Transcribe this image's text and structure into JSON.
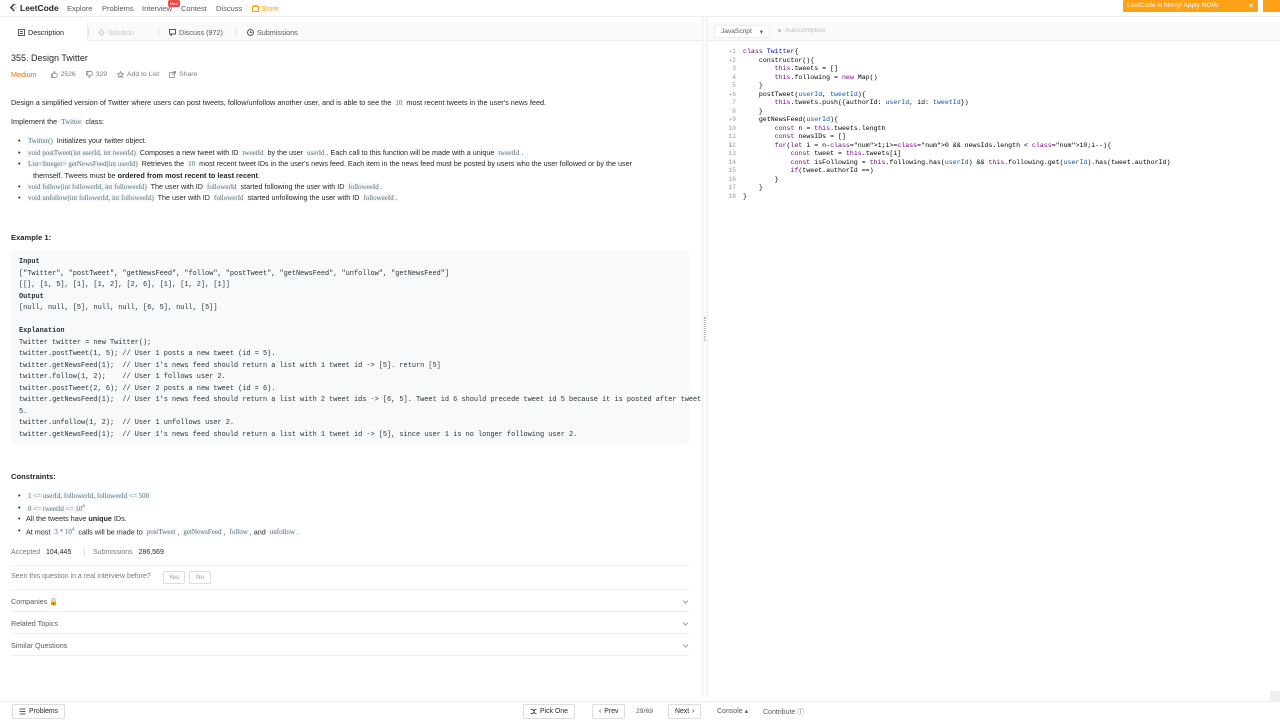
{
  "nav": {
    "logo": "LeetCode",
    "links": [
      "Explore",
      "Problems",
      "Interview",
      "Contest",
      "Discuss",
      "Store"
    ],
    "new_badge": "New",
    "hiring": "LeetCode is hiring! Apply NOW."
  },
  "tabs": [
    {
      "label": "Description",
      "state": "active"
    },
    {
      "label": "Solution",
      "state": "disabled"
    },
    {
      "label": "Discuss (972)",
      "state": "normal"
    },
    {
      "label": "Submissions",
      "state": "normal"
    }
  ],
  "question": {
    "title": "355. Design Twitter",
    "difficulty": "Medium",
    "likes": "2526",
    "dislikes": "329",
    "add_to_list": "Add to List",
    "share": "Share",
    "desc_a": "Design a simplified version of Twitter where users can post tweets, follow/unfollow another user, and is able to see the",
    "desc_code": "10",
    "desc_b": "most recent tweets in the user's news feed.",
    "implement_a": "Implement the",
    "implement_code": "Twitter",
    "implement_b": "class:",
    "methods": [
      {
        "sig": "Twitter()",
        "text": "Initializes your twitter object."
      },
      {
        "sig": "void postTweet(int userId, int tweetId)",
        "text_a": "Composes a new tweet with ID",
        "c1": "tweetId",
        "text_b": "by the user",
        "c2": "userId",
        "text_c": ". Each call to this function will be made with a unique",
        "c3": "tweetId",
        "text_d": "."
      },
      {
        "sig": "List<Integer> getNewsFeed(int userId)",
        "text_a": "Retrieves the",
        "c1": "10",
        "text_b": "most recent tweet IDs in the user's news feed. Each item in the news feed must be posted by users who the user followed or by the user",
        "line2_a": "themself. Tweets must be",
        "line2_bold": "ordered from most recent to least recent",
        "line2_b": "."
      },
      {
        "sig": "void follow(int followerId, int followeeId)",
        "text_a": "The user with ID",
        "c1": "followerId",
        "text_b": "started following the user with ID",
        "c2": "followeeId",
        "text_c": "."
      },
      {
        "sig": "void unfollow(int followerId, int followeeId)",
        "text_a": "The user with ID",
        "c1": "followerId",
        "text_b": "started unfollowing the user with ID",
        "c2": "followeeId",
        "text_c": "."
      }
    ],
    "example_title": "Example 1:",
    "example": {
      "input_label": "Input",
      "input_1": "[\"Twitter\", \"postTweet\", \"getNewsFeed\", \"follow\", \"postTweet\", \"getNewsFeed\", \"unfollow\", \"getNewsFeed\"]",
      "input_2": "[[], [1, 5], [1], [1, 2], [2, 6], [1], [1, 2], [1]]",
      "output_label": "Output",
      "output_1": "[null, null, [5], null, null, [6, 5], null, [5]]",
      "explanation_label": "Explanation",
      "explanation": [
        "Twitter twitter = new Twitter();",
        "twitter.postTweet(1, 5); // User 1 posts a new tweet (id = 5).",
        "twitter.getNewsFeed(1);  // User 1's news feed should return a list with 1 tweet id -> [5]. return [5]",
        "twitter.follow(1, 2);    // User 1 follows user 2.",
        "twitter.postTweet(2, 6); // User 2 posts a new tweet (id = 6).",
        "twitter.getNewsFeed(1);  // User 1's news feed should return a list with 2 tweet ids -> [6, 5]. Tweet id 6 should precede tweet id 5 because it is posted after tweet id",
        "5.",
        "twitter.unfollow(1, 2);  // User 1 unfollows user 2.",
        "twitter.getNewsFeed(1);  // User 1's news feed should return a list with 1 tweet id -> [5], since user 1 is no longer following user 2."
      ]
    },
    "constraints_title": "Constraints:",
    "constraints": {
      "c1": "1 <= userId, followerId, followeeId <= 500",
      "c2": "0 <= tweetId <= 10",
      "c2_sup": "4",
      "c3_a": "All the tweets have",
      "c3_bold": "unique",
      "c3_b": "IDs.",
      "c4_a": "At most",
      "c4_code": "3 * 10",
      "c4_sup": "4",
      "c4_b": "calls will be made to",
      "c4_m1": "postTweet",
      "c4_m2": "getNewsFeed",
      "c4_m3": "follow",
      "c4_and": ", and",
      "c4_m4": "unfollow",
      "c4_end": "."
    },
    "accepted_label": "Accepted",
    "accepted": "104,445",
    "submissions_label": "Submissions",
    "submissions": "286,569",
    "seen_question": "Seen this question in a real interview before?",
    "yes": "Yes",
    "no": "No",
    "sections": [
      "Companies",
      "Related Topics",
      "Similar Questions"
    ]
  },
  "editor": {
    "language": "JavaScript",
    "autocomplete": "Autocomplete",
    "lines": [
      "class Twitter{",
      "    constructor(){",
      "        this.tweets = []",
      "        this.following = new Map()",
      "    }",
      "    postTweet(userId, tweetId){",
      "        this.tweets.push({authorId: userId, id: tweetId})",
      "    }",
      "    getNewsFeed(userId){",
      "        const n = this.tweets.length",
      "        const newsIDs = []",
      "        for(let i = n-1;i>=0 && newsIds.length < 10;i--){",
      "            const tweet = this.tweets[i]",
      "            const isFollowing = this.following.has(userId) && this.following.get(userId).has(tweet.authorId)",
      "            if(tweet.authorId ==)",
      "        }",
      "    }",
      "}"
    ]
  },
  "bottom": {
    "problems": "Problems",
    "pick_one": "Pick One",
    "prev": "Prev",
    "page": "29/69",
    "next": "Next",
    "console": "Console",
    "contribute": "Contribute"
  },
  "colors": {
    "accent": "#ffa116",
    "medium": "#ef6c00",
    "new_badge": "#ef4743"
  }
}
